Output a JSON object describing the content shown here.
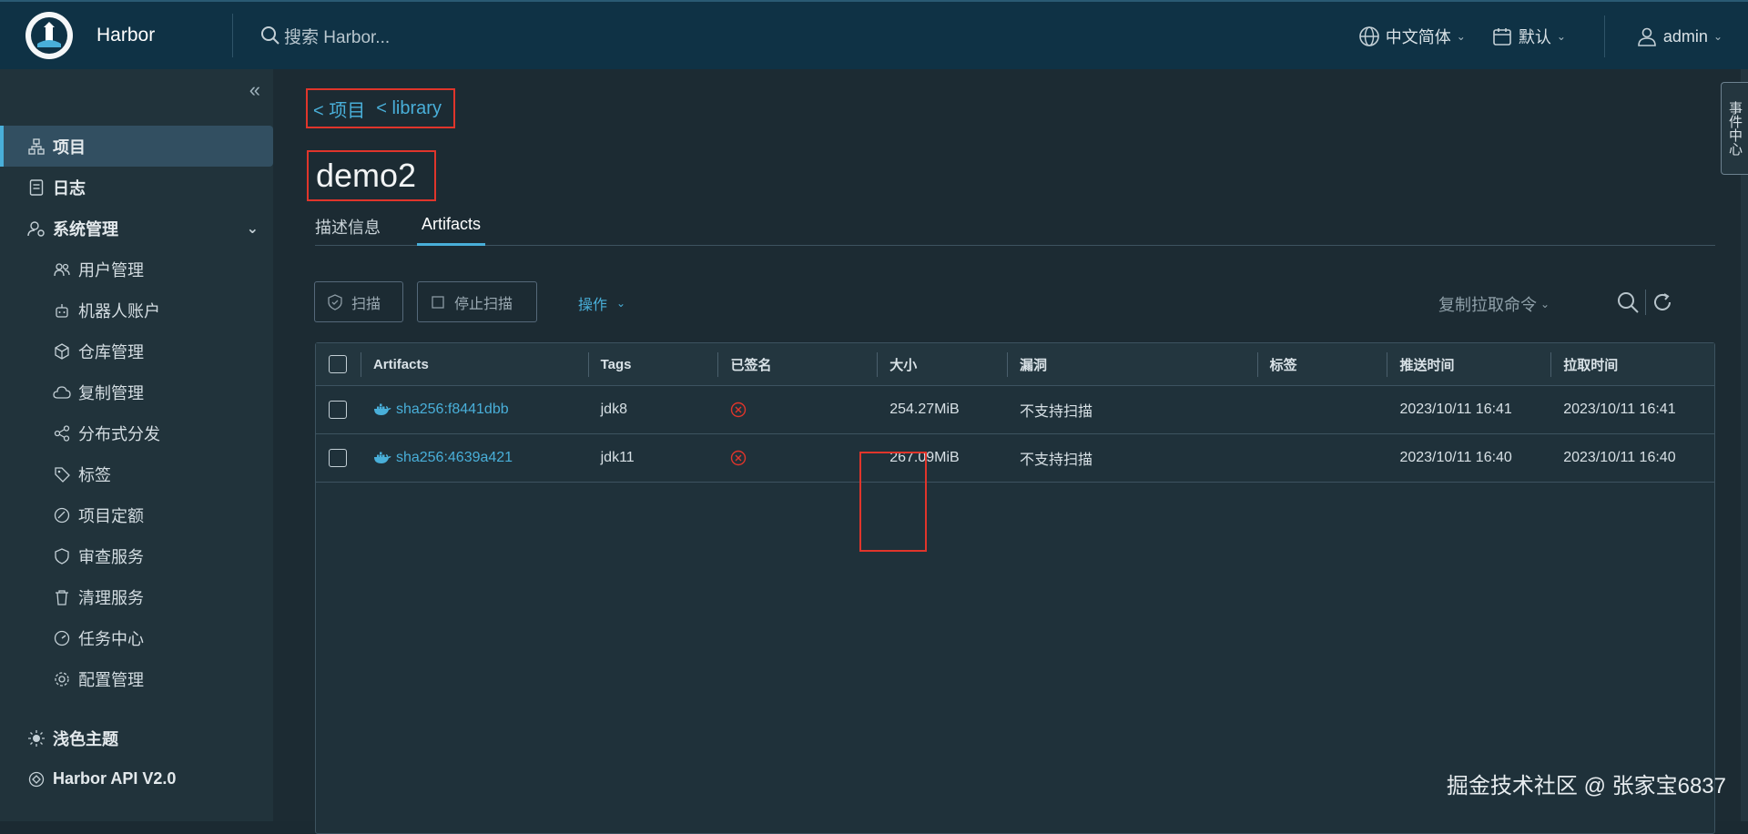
{
  "header": {
    "app_name": "Harbor",
    "search_placeholder": "搜索 Harbor...",
    "language": "中文简体",
    "calendar": "默认",
    "user": "admin"
  },
  "sidebar": {
    "items": [
      {
        "label": "项目",
        "icon": "projects-icon",
        "active": true
      },
      {
        "label": "日志",
        "icon": "logs-icon"
      },
      {
        "label": "系统管理",
        "icon": "admin-icon",
        "expanded": true
      },
      {
        "label": "用户管理",
        "icon": "users-icon"
      },
      {
        "label": "机器人账户",
        "icon": "robot-icon"
      },
      {
        "label": "仓库管理",
        "icon": "registry-icon"
      },
      {
        "label": "复制管理",
        "icon": "replication-icon"
      },
      {
        "label": "分布式分发",
        "icon": "distribution-icon"
      },
      {
        "label": "标签",
        "icon": "tag-icon"
      },
      {
        "label": "项目定额",
        "icon": "quota-icon"
      },
      {
        "label": "审查服务",
        "icon": "shield-icon"
      },
      {
        "label": "清理服务",
        "icon": "trash-icon"
      },
      {
        "label": "任务中心",
        "icon": "dashboard-icon"
      },
      {
        "label": "配置管理",
        "icon": "config-icon"
      }
    ],
    "theme": "浅色主题",
    "api": "Harbor API V2.0"
  },
  "breadcrumb": {
    "project": "< 项目",
    "repo": "< library"
  },
  "page_title": "demo2",
  "tabs": [
    "描述信息",
    "Artifacts"
  ],
  "active_tab": "Artifacts",
  "toolbar": {
    "scan": "扫描",
    "stop_scan": "停止扫描",
    "action": "操作",
    "copy_pull": "复制拉取命令"
  },
  "grid": {
    "columns": [
      "Artifacts",
      "Tags",
      "已签名",
      "大小",
      "漏洞",
      "标签",
      "推送时间",
      "拉取时间"
    ],
    "rows": [
      {
        "artifact": "sha256:f8441dbb",
        "tag": "jdk8",
        "signed": "not-signed-icon",
        "size": "254.27MiB",
        "vulnerability": "不支持扫描",
        "label": "",
        "push_time": "2023/10/11 16:41",
        "pull_time": "2023/10/11 16:41"
      },
      {
        "artifact": "sha256:4639a421",
        "tag": "jdk11",
        "signed": "not-signed-icon",
        "size": "267.09MiB",
        "vulnerability": "不支持扫描",
        "label": "",
        "push_time": "2023/10/11 16:40",
        "pull_time": "2023/10/11 16:40"
      }
    ]
  },
  "event_tab": "事件中心",
  "watermark": "掘金技术社区 @ 张家宝6837",
  "colors": {
    "accent": "#49afd9",
    "highlight_box": "#e0352b",
    "header_bg": "#0f3245",
    "sidebar_bg": "#21333b"
  }
}
